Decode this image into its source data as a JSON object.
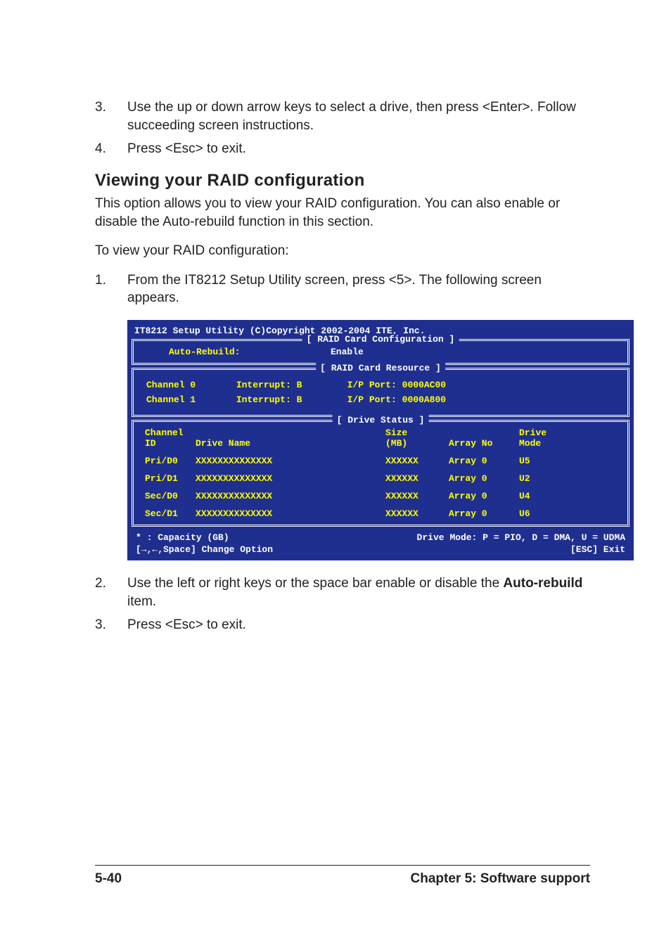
{
  "steps_a": [
    {
      "n": "3.",
      "text": "Use the up or down arrow keys to select a drive, then press <Enter>. Follow succeeding screen instructions."
    },
    {
      "n": "4.",
      "text": "Press <Esc> to exit."
    }
  ],
  "heading": "Viewing your RAID configuration",
  "intro1": "This option allows you to view your RAID configuration. You can also enable or disable the Auto-rebuild function in this section.",
  "intro2": "To view your RAID configuration:",
  "steps_b1": {
    "n": "1.",
    "text": "From the IT8212 Setup Utility screen, press <5>. The following screen appears."
  },
  "steps_b2": {
    "n": "2.",
    "prefix": "Use the left or right keys or the space bar enable or disable the ",
    "bold": "Auto-rebuild",
    "suffix": " item."
  },
  "steps_b3": {
    "n": "3.",
    "text": "Press <Esc> to exit."
  },
  "bios": {
    "title": "IT8212 Setup Utility (C)Copyright 2002-2004 ITE, Inc.",
    "panels": {
      "config": {
        "label": "[ RAID Card Configuration ]",
        "auto_rebuild_label": "Auto-Rebuild:",
        "auto_rebuild_value": "Enable"
      },
      "resource": {
        "label": "[ RAID Card Resource ]",
        "channels": [
          {
            "chan": "Channel 0",
            "interrupt": "Interrupt: B",
            "ipport": "I/P Port: 0000AC00"
          },
          {
            "chan": "Channel 1",
            "interrupt": "Interrupt: B",
            "ipport": "I/P Port: 0000A800"
          }
        ]
      },
      "drives": {
        "label": "[ Drive Status ]",
        "header1": {
          "id": "Channel",
          "name": "",
          "size": "Size",
          "array": "",
          "mode": "Drive"
        },
        "header2": {
          "id": " ID",
          "name": "Drive Name",
          "size": "(MB)",
          "array": "Array No",
          "mode": "Mode"
        },
        "rows": [
          {
            "id": "Pri/D0",
            "name": "XXXXXXXXXXXXXX",
            "size": "XXXXXX",
            "array": "Array 0",
            "mode": "U5"
          },
          {
            "id": "Pri/D1",
            "name": "XXXXXXXXXXXXXX",
            "size": "XXXXXX",
            "array": "Array 0",
            "mode": "U2"
          },
          {
            "id": "Sec/D0",
            "name": "XXXXXXXXXXXXXX",
            "size": "XXXXXX",
            "array": "Array 0",
            "mode": "U4"
          },
          {
            "id": "Sec/D1",
            "name": "XXXXXXXXXXXXXX",
            "size": "XXXXXX",
            "array": "Array 0",
            "mode": "U6"
          }
        ]
      }
    },
    "footer": {
      "left1": "* : Capacity (GB)",
      "right1": "Drive Mode: P = PIO, D = DMA, U = UDMA",
      "left2": "[→,←,Space] Change Option",
      "right2": "[ESC] Exit"
    }
  },
  "page_footer": {
    "left": "5-40",
    "right": "Chapter 5: Software support"
  }
}
